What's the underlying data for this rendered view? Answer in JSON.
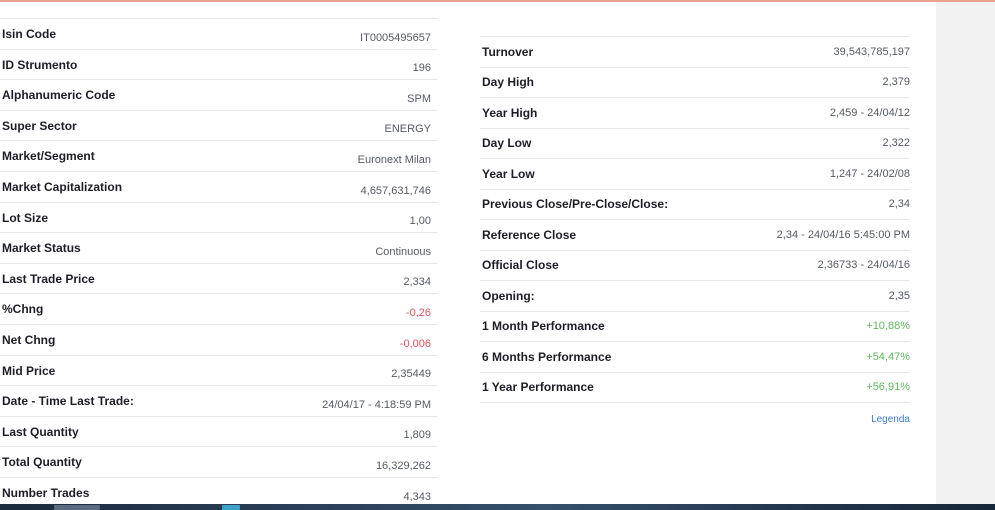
{
  "left_table": {
    "rows": [
      {
        "label": "Isin Code",
        "value": "IT0005495657"
      },
      {
        "label": "ID Strumento",
        "value": "196"
      },
      {
        "label": "Alphanumeric Code",
        "value": "SPM"
      },
      {
        "label": "Super Sector",
        "value": "ENERGY"
      },
      {
        "label": "Market/Segment",
        "value": "Euronext Milan"
      },
      {
        "label": "Market Capitalization",
        "value": "4,657,631,746"
      },
      {
        "label": "Lot Size",
        "value": "1,00"
      },
      {
        "label": "Market Status",
        "value": "Continuous"
      },
      {
        "label": "Last Trade Price",
        "value": "2,334"
      },
      {
        "label": "%Chng",
        "value": "-0,26"
      },
      {
        "label": "Net Chng",
        "value": "-0,006"
      },
      {
        "label": "Mid Price",
        "value": "2,35449"
      },
      {
        "label": "Date - Time Last Trade:",
        "value": "24/04/17 - 4:18:59 PM"
      },
      {
        "label": "Last Quantity",
        "value": "1,809"
      },
      {
        "label": "Total Quantity",
        "value": "16,329,262"
      },
      {
        "label": "Number Trades",
        "value": "4,343"
      }
    ]
  },
  "right_table": {
    "rows": [
      {
        "label": "Turnover",
        "value": "39,543,785,197"
      },
      {
        "label": "Day High",
        "value": "2,379"
      },
      {
        "label": "Year High",
        "value": "2,459 - 24/04/12"
      },
      {
        "label": "Day Low",
        "value": "2,322"
      },
      {
        "label": "Year Low",
        "value": "1,247 - 24/02/08"
      },
      {
        "label": "Previous Close/Pre-Close/Close:",
        "value": "2,34"
      },
      {
        "label": "Reference Close",
        "value": "2,34 - 24/04/16 5:45:00 PM"
      },
      {
        "label": "Official Close",
        "value": "2,36733 - 24/04/16"
      },
      {
        "label": "Opening:",
        "value": "2,35"
      },
      {
        "label": "1 Month Performance",
        "value": "+10,88%"
      },
      {
        "label": "6 Months Performance",
        "value": "+54,47%"
      },
      {
        "label": "1 Year Performance",
        "value": "+56,91%"
      }
    ]
  },
  "legend_link": "Legenda",
  "colors": {
    "negative": "#e0505a",
    "positive": "#5fb75f",
    "link": "#3a7bd5",
    "label": "#1d1d28",
    "value": "#555a63"
  }
}
